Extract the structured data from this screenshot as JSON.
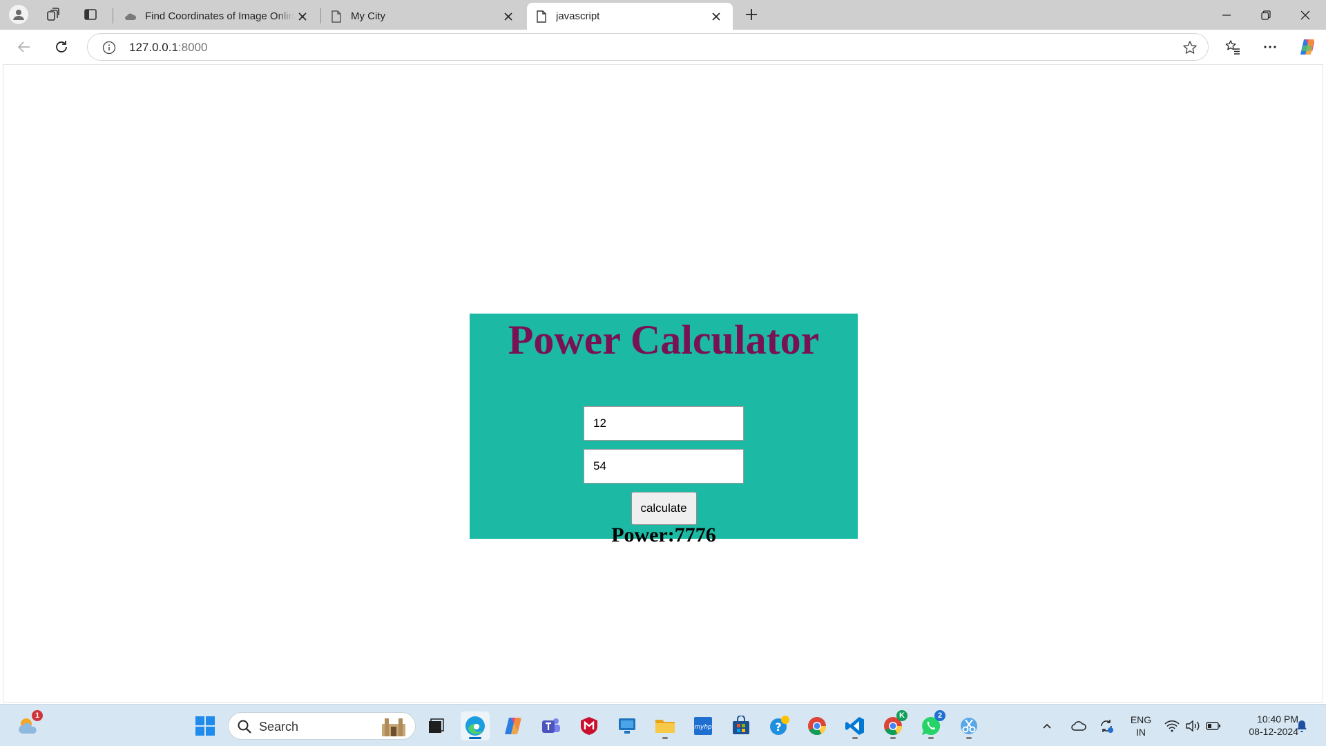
{
  "browser": {
    "tabs": [
      {
        "title": "Find Coordinates of Image Online",
        "icon": "cloud-favicon-icon"
      },
      {
        "title": "My City",
        "icon": "page-favicon-icon"
      },
      {
        "title": "javascript",
        "icon": "page-favicon-icon",
        "active": true
      }
    ],
    "url_host": "127.0.0.1",
    "url_port": ":8000"
  },
  "page": {
    "title": "Power Calculator",
    "base_value": "12",
    "exponent_value": "54",
    "button_label": "calculate",
    "result_text": "Power:7776"
  },
  "taskbar": {
    "search_placeholder": "Search",
    "weather_badge": "1",
    "whatsapp_badge": "2",
    "chrome_profile_badge": "K",
    "lang_top": "ENG",
    "lang_bottom": "IN",
    "time": "10:40 PM",
    "date": "08-12-2024"
  },
  "colors": {
    "calc_bg": "#1cbaa5",
    "calc_title": "#791155",
    "tabstrip_bg": "#cfcfcf",
    "taskbar_bg": "#d6e6f2"
  }
}
